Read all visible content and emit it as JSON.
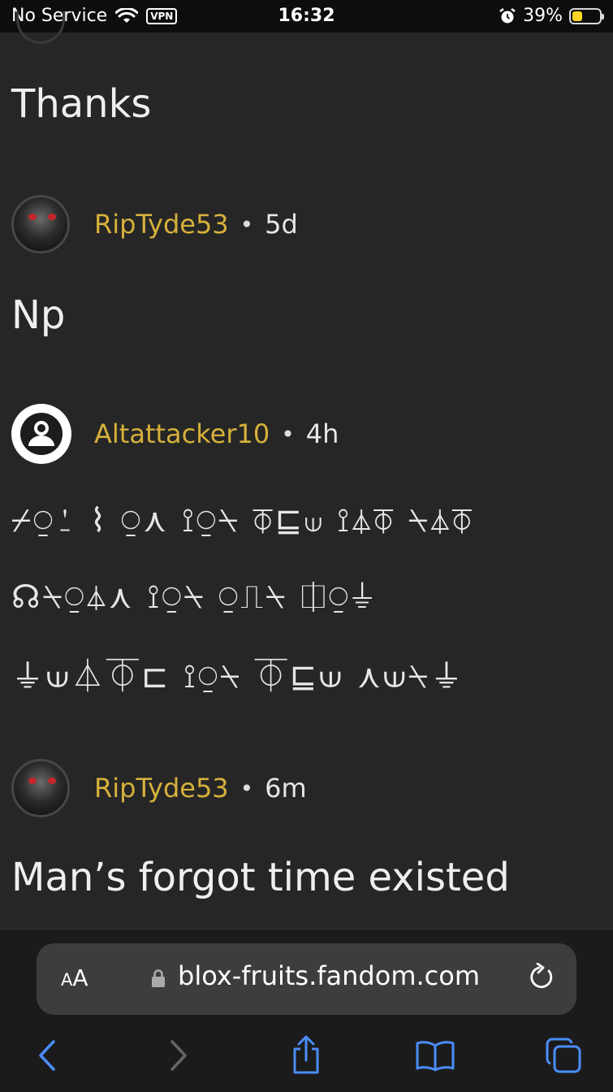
{
  "status_bar": {
    "carrier": "No Service",
    "vpn_label": "VPN",
    "time": "16:32",
    "battery_percent_text": "39%",
    "battery_level": 0.39,
    "battery_color": "#ffd426"
  },
  "comments": [
    {
      "body": "Thanks"
    },
    {
      "username": "RipTyde53",
      "separator": "•",
      "age": "5d",
      "body": "Np",
      "avatar": "dark-armor-avatar"
    },
    {
      "username": "Altattacker10",
      "separator": "•",
      "age": "4h",
      "avatar": "default-user-icon",
      "body_lines": [
        "⌿⍜⍘ ⌇ ⍜⋏ ⟟⍜⍀ ⏁⊑⟒ ⟟⏃⏁ ⍀⏃⏁",
        "☊⍀⍜⏃⋏ ⟟⍜⍀ ⍜⎍⍀ ⎅⍜⏚",
        "⏚⟒⏃⏁⊏ ⟟⍜⍀ ⏁⊑⟒ ⋏⟒⍀⏚"
      ]
    },
    {
      "username": "RipTyde53",
      "separator": "•",
      "age": "6m",
      "body": "Man’s forgot time existed",
      "avatar": "dark-armor-avatar"
    }
  ],
  "browser": {
    "aa_label_big": "A",
    "aa_label_small": "A",
    "url": "blox-fruits.fandom.com",
    "accent_color": "#4a8df7"
  }
}
